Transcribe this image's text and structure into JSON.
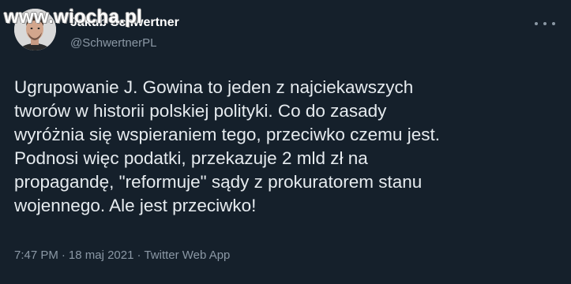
{
  "watermark": "www.wiocha.pl",
  "author": {
    "display_name": "Jakub Schwertner",
    "handle": "@SchwertnerPL"
  },
  "tweet": {
    "lines": [
      "Ugrupowanie J. Gowina to jeden z najciekawszych",
      "tworów w historii polskiej polityki. Co do zasady",
      "wyróżnia się wspieraniem tego, przeciwko czemu jest.",
      "Podnosi więc podatki, przekazuje 2 mld zł na",
      "propagandę, \"reformuje\" sądy z prokuratorem stanu",
      "wojennego. Ale jest przeciwko!"
    ],
    "time": "7:47 PM",
    "separator": "·",
    "date": "18 maj 2021",
    "source": "Twitter Web App"
  },
  "icons": {
    "more": "more-horizontal-icon"
  },
  "colors": {
    "background": "#15202b",
    "text": "#e6ebef",
    "secondary_text": "#8b98a5"
  }
}
